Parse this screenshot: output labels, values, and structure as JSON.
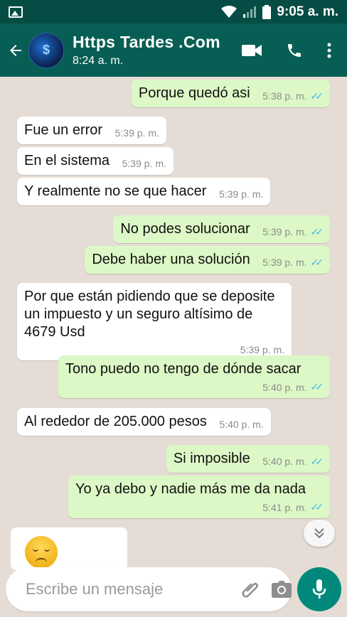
{
  "status_bar": {
    "time": "9:05 a. m."
  },
  "header": {
    "title": "Https Tardes .Com",
    "subtitle": "8:24 a. m.",
    "avatar_text": "$"
  },
  "messages": [
    {
      "dir": "out",
      "text": "Porque quedó asi",
      "time": "5:38 p. m.",
      "ticks": "✓✓"
    },
    {
      "dir": "in",
      "text": "Fue un error",
      "time": "5:39 p. m."
    },
    {
      "dir": "in",
      "text": "En el sistema",
      "time": "5:39 p. m."
    },
    {
      "dir": "in",
      "text": "Y realmente no se que hacer",
      "time": "5:39 p. m."
    },
    {
      "dir": "out",
      "text": "No podes solucionar",
      "time": "5:39 p. m.",
      "ticks": "✓✓"
    },
    {
      "dir": "out",
      "text": "Debe haber una solución",
      "time": "5:39 p. m.",
      "ticks": "✓✓"
    },
    {
      "dir": "in",
      "text": "Por que están pidiendo que se deposite un impuesto y un seguro altísimo de 4679 Usd",
      "time": "5:39 p. m."
    },
    {
      "dir": "out",
      "text": "Tono puedo no tengo de dónde sacar",
      "time": "5:40 p. m.",
      "ticks": "✓✓"
    },
    {
      "dir": "in",
      "text": "Al rededor de 205.000 pesos",
      "time": "5:40 p. m."
    },
    {
      "dir": "out",
      "text": "Si imposible",
      "time": "5:40 p. m.",
      "ticks": "✓✓"
    },
    {
      "dir": "out",
      "text": "Yo ya debo y nadie más me da nada",
      "time": "5:41 p. m.",
      "ticks": "✓✓"
    }
  ],
  "input": {
    "placeholder": "Escribe un mensaje"
  },
  "icons": {
    "status_left": "image-icon",
    "back": "arrow-left-icon",
    "video": "video-call-icon",
    "phone": "phone-icon",
    "menu": "more-vert-icon",
    "emoji": "emoji-icon",
    "attach": "paperclip-icon",
    "camera": "camera-icon",
    "mic": "microphone-icon",
    "scroll": "chevron-double-down-icon"
  },
  "colors": {
    "header": "#075e54",
    "status_bar": "#054d44",
    "outgoing": "#dcf8c6",
    "incoming": "#ffffff",
    "chat_bg": "#e5ddd5",
    "mic_button": "#00897b",
    "read_ticks": "#4fb6ec"
  }
}
